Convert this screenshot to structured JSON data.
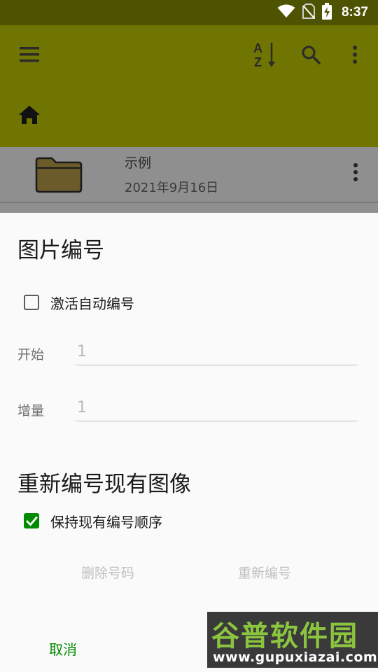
{
  "status_bar": {
    "time": "8:37",
    "icons": [
      "wifi-icon",
      "no-sim-icon",
      "battery-charging-icon"
    ]
  },
  "toolbar": {
    "icons": [
      "menu-icon",
      "sort-az-icon",
      "search-icon",
      "more-vert-icon"
    ]
  },
  "breadcrumb": {
    "icon": "home-icon"
  },
  "file_list": [
    {
      "name": "示例",
      "date": "2021年9月16日",
      "icon": "folder-icon"
    }
  ],
  "dialog": {
    "title": "图片编号",
    "activate_auto_label": "激活自动编号",
    "activate_auto_checked": false,
    "start_label": "开始",
    "start_placeholder": "1",
    "increment_label": "增量",
    "increment_placeholder": "1",
    "renumber_title": "重新编号现有图像",
    "keep_order_label": "保持现有编号顺序",
    "keep_order_checked": true,
    "remove_number_label": "删除号码",
    "renumber_label": "重新编号",
    "cancel_label": "取消"
  },
  "watermark": {
    "text_top": "谷普软件园",
    "text_bottom": "www.gupuxiazai.com"
  },
  "colors": {
    "toolbar": "#6f7500",
    "status_bar": "#4e5302",
    "accent": "#008a00"
  }
}
